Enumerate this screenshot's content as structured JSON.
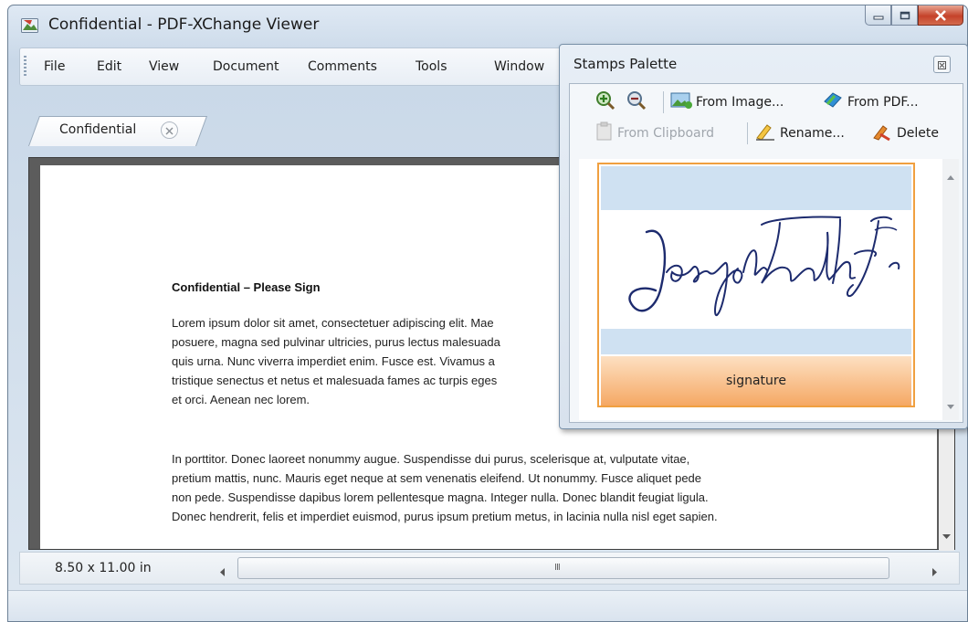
{
  "window": {
    "title": "Confidential - PDF-XChange Viewer",
    "controls": [
      "minimize-icon",
      "maximize-icon",
      "close-icon"
    ]
  },
  "menu": {
    "items": [
      "File",
      "Edit",
      "View",
      "Document",
      "Comments",
      "Tools",
      "Window"
    ]
  },
  "tabs": [
    {
      "label": "Confidential"
    }
  ],
  "document": {
    "title": "Confidential – Please Sign",
    "paragraph1": [
      "Lorem ipsum dolor sit amet, consectetuer adipiscing elit. Mae",
      "posuere, magna sed pulvinar ultricies, purus lectus malesuada",
      "quis urna. Nunc viverra imperdiet enim. Fusce est. Vivamus a",
      "tristique senectus et netus et malesuada fames ac turpis eges",
      "et orci. Aenean nec lorem."
    ],
    "paragraph2": [
      "In porttitor. Donec laoreet nonummy augue. Suspendisse dui purus, scelerisque at, vulputate vitae,",
      "pretium mattis, nunc. Mauris eget neque at sem venenatis eleifend. Ut nonummy. Fusce aliquet pede",
      "non pede. Suspendisse dapibus lorem pellentesque magna. Integer nulla. Donec blandit feugiat ligula.",
      "Donec hendrerit, felis et imperdiet euismod, purus ipsum pretium metus, in lacinia nulla nisl eget sapien."
    ]
  },
  "status": {
    "page_size": "8.50 x 11.00 in",
    "scroll_grip": "III"
  },
  "palette": {
    "title": "Stamps Palette",
    "toolbar_row1": {
      "zoom_in_icon": "zoom-in-icon",
      "zoom_out_icon": "zoom-out-icon",
      "from_image": "From Image...",
      "from_pdf": "From PDF..."
    },
    "toolbar_row2": {
      "from_clipboard": "From Clipboard",
      "rename": "Rename...",
      "delete": "Delete"
    },
    "stamps": [
      {
        "name": "signature",
        "image": "handwritten signature (Joseph Smith Jr)"
      }
    ]
  },
  "colors": {
    "selection_border": "#f0a040",
    "stamp_label_gradient_end": "#f5a864",
    "close_button": "#c5422a"
  }
}
